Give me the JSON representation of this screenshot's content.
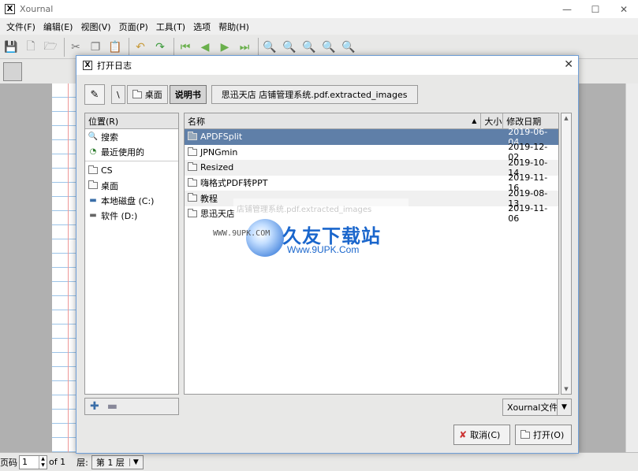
{
  "window": {
    "title": "Xournal",
    "min": "—",
    "max": "☐",
    "close": "✕"
  },
  "menu": [
    "文件(F)",
    "编辑(E)",
    "视图(V)",
    "页面(P)",
    "工具(T)",
    "选项",
    "帮助(H)"
  ],
  "toolbar_icons": [
    "save-icon",
    "new-icon",
    "open-icon",
    "cut-icon",
    "copy-icon",
    "paste-icon",
    "undo-icon",
    "redo-icon",
    "first-page-icon",
    "prev-page-icon",
    "next-page-icon",
    "last-page-icon",
    "zoom-out-icon",
    "zoom-fit-icon",
    "zoom-in-icon",
    "zoom-100-icon",
    "zoom-find-icon"
  ],
  "status": {
    "page_label": "页码",
    "page_value": "1",
    "of_label": "of 1",
    "layer_label": "层:",
    "layer_value": "第 1 层"
  },
  "dialog": {
    "title": "打开日志",
    "breadcrumb": {
      "root": "\\",
      "desktop": "桌面",
      "current": "说明书",
      "next": "思迅天店 店铺管理系统.pdf.extracted_images"
    },
    "places": {
      "header": "位置(R)",
      "items": [
        {
          "label": "搜索",
          "icon": "search-icon"
        },
        {
          "label": "最近使用的",
          "icon": "recent-icon"
        }
      ],
      "locations": [
        {
          "label": "CS",
          "icon": "folder-icon"
        },
        {
          "label": "桌面",
          "icon": "folder-icon"
        },
        {
          "label": "本地磁盘 (C:)",
          "icon": "drive-icon"
        },
        {
          "label": "软件 (D:)",
          "icon": "drive-icon"
        }
      ]
    },
    "files": {
      "columns": {
        "name": "名称",
        "size": "大小",
        "date": "修改日期"
      },
      "rows": [
        {
          "name": "APDFSplit",
          "size": "",
          "date": "2019-06-04",
          "selected": true
        },
        {
          "name": "JPNGmin",
          "size": "",
          "date": "2019-12-02"
        },
        {
          "name": "Resized",
          "size": "",
          "date": "2019-10-14"
        },
        {
          "name": "嗨格式PDF转PPT",
          "size": "",
          "date": "2019-11-16"
        },
        {
          "name": "教程",
          "size": "",
          "date": "2019-08-13"
        },
        {
          "name": "思迅天店",
          "size": "",
          "date": "2019-11-06"
        }
      ]
    },
    "filter": "Xournal文件",
    "cancel": "取消(C)",
    "open": "打开(O)"
  },
  "watermark": {
    "www": "WWW.9UPK.COM",
    "cn": "久友下载站",
    "url": "Www.9UPK.Com",
    "ghost": "店铺管理系统.pdf.extracted_images"
  },
  "colors": {
    "selection": "#5f7fa8",
    "accent": "#1a66cc"
  }
}
